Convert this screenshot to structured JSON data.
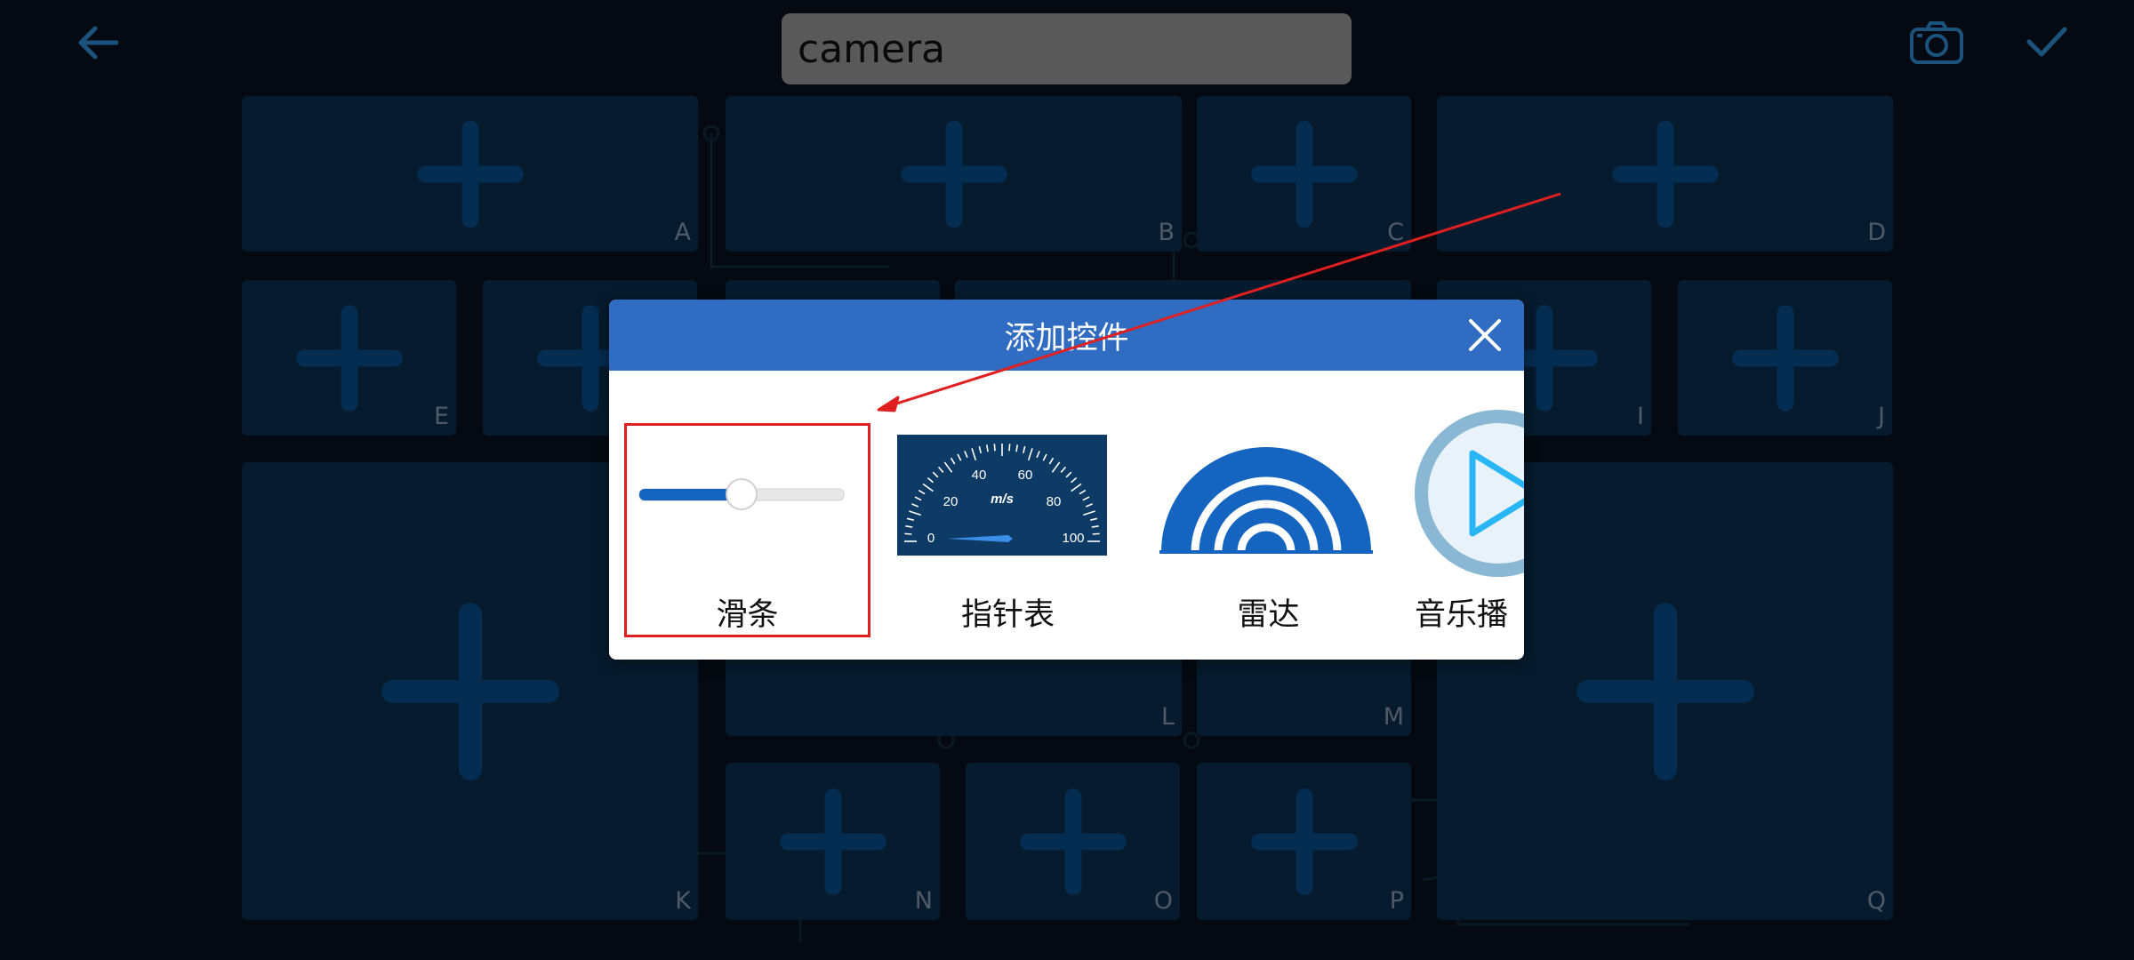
{
  "topbar": {
    "back_icon": "arrow-left-icon",
    "title_value": "camera",
    "camera_icon": "camera-icon",
    "confirm_icon": "check-icon"
  },
  "grid": {
    "cells": [
      {
        "letter": "A"
      },
      {
        "letter": "B"
      },
      {
        "letter": "C"
      },
      {
        "letter": "D"
      },
      {
        "letter": "E"
      },
      {
        "letter": ""
      },
      {
        "letter": ""
      },
      {
        "letter": ""
      },
      {
        "letter": "I"
      },
      {
        "letter": "J"
      },
      {
        "letter": "K"
      },
      {
        "letter": "L"
      },
      {
        "letter": "M"
      },
      {
        "letter": "Q"
      },
      {
        "letter": "N"
      },
      {
        "letter": "O"
      },
      {
        "letter": "P"
      }
    ]
  },
  "dialog": {
    "title": "添加控件",
    "close_icon": "close-icon",
    "widgets": [
      {
        "label": "滑条",
        "icon": "slider-icon",
        "slider_value": 0.5
      },
      {
        "label": "指针表",
        "icon": "gauge-icon",
        "gauge_unit": "m/s",
        "gauge_ticks": [
          "0",
          "20",
          "40",
          "60",
          "80",
          "100"
        ]
      },
      {
        "label": "雷达",
        "icon": "radar-icon"
      },
      {
        "label": "音乐播",
        "icon": "play-icon"
      }
    ]
  },
  "colors": {
    "accent": "#2f6cc2",
    "cell": "#0c2f50",
    "plus": "#0a4d8c",
    "highlight": "#e02020"
  }
}
